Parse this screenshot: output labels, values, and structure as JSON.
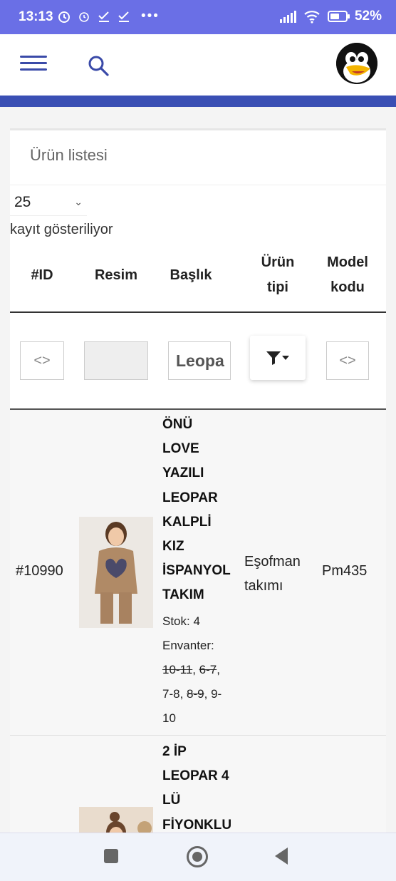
{
  "status_bar": {
    "time": "13:13",
    "battery": "52%"
  },
  "colors": {
    "status_bar": "#6a6fe6",
    "accent": "#3a4fb4",
    "icon": "#3a4aa8"
  },
  "card": {
    "title": "Ürün listesi",
    "page_length": "25",
    "info_text": "kayıt gösteriliyor"
  },
  "table": {
    "headers": {
      "id": "#ID",
      "image": "Resim",
      "title": "Başlık",
      "type_l1": "Ürün",
      "type_l2": "tipi",
      "model_l1": "Model",
      "model_l2": "kodu"
    },
    "filters": {
      "id": "<>",
      "title_value": "Leopa",
      "model": "<>"
    },
    "rows": [
      {
        "id": "#10990",
        "title_lines": [
          "ÖNÜ",
          "LOVE",
          "YAZILI",
          "LEOPAR",
          "KALPLİ",
          "KIZ",
          "İSPANYOL",
          "TAKIM"
        ],
        "stock": "Stok: 4",
        "inventory_label": "Envanter:",
        "inv_1": "10-11",
        "inv_2": "6-7",
        "inv_3": "7-8",
        "inv_4": "8-9",
        "inv_5a": "9-",
        "inv_5b": "10",
        "type_l1": "Eşofman",
        "type_l2": "takımı",
        "model": "Pm435"
      },
      {
        "title_lines": [
          "2 İP",
          "LEOPAR 4",
          "LÜ",
          "FİYONKLU"
        ]
      }
    ]
  }
}
